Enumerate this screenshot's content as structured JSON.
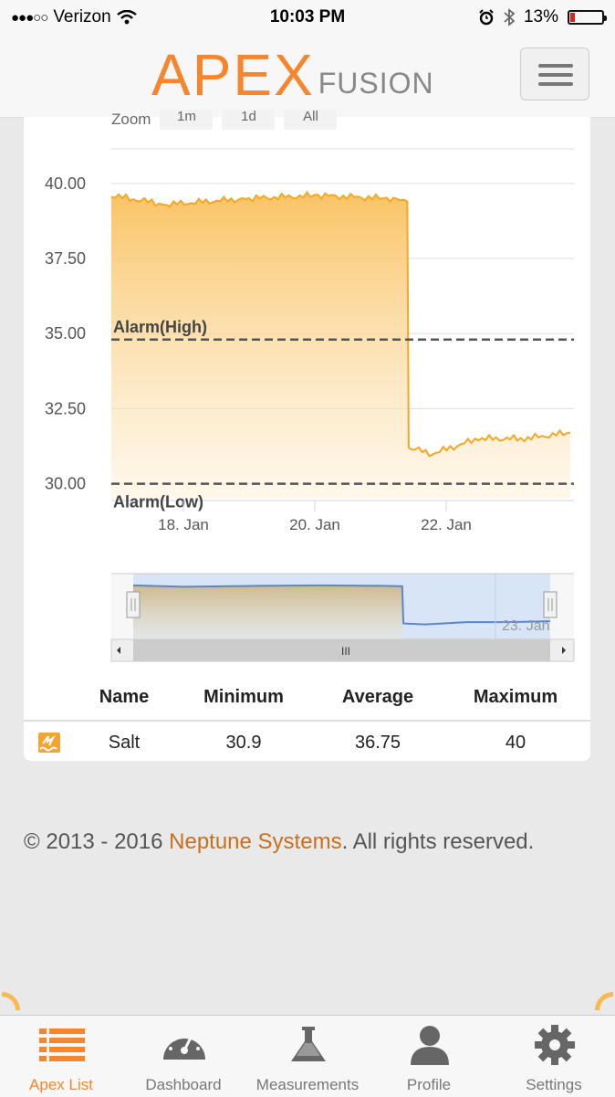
{
  "status_bar": {
    "carrier": "Verizon",
    "time": "10:03 PM",
    "battery": "13%",
    "battery_level": 0.13
  },
  "header": {
    "logo_main": "APEX",
    "logo_sub": "FUSION",
    "menu_icon": "hamburger-icon"
  },
  "chart": {
    "zoom_label": "Zoom",
    "zoom_buttons": [
      "1m",
      "1d",
      "All"
    ]
  },
  "chart_data": {
    "type": "area",
    "title": "",
    "xlabel": "",
    "ylabel": "",
    "ylim": [
      29.5,
      41.0
    ],
    "y_ticks": [
      "40.00",
      "37.50",
      "35.00",
      "32.50",
      "30.00"
    ],
    "x_tick_labels": [
      "18. Jan",
      "20. Jan",
      "22. Jan"
    ],
    "navigator_label": "23. Jan",
    "plot_lines": [
      {
        "label": "Alarm(High)",
        "value": 34.8
      },
      {
        "label": "Alarm(Low)",
        "value": 30.0
      }
    ],
    "series": [
      {
        "name": "Salt",
        "color": "#f5a623",
        "x": [
          "17. Jan",
          "18. Jan",
          "19. Jan",
          "20. Jan",
          "21. Jan",
          "21.5 Jan",
          "21.6 Jan",
          "22. Jan",
          "22.5 Jan",
          "23. Jan",
          "23.5 Jan"
        ],
        "values": [
          39.6,
          39.3,
          39.5,
          39.6,
          39.5,
          39.4,
          31.2,
          31.0,
          31.5,
          31.5,
          31.7
        ]
      }
    ]
  },
  "table": {
    "headers": [
      "Name",
      "Minimum",
      "Average",
      "Maximum"
    ],
    "rows": [
      {
        "icon": "salt-icon",
        "name": "Salt",
        "min": "30.9",
        "avg": "36.75",
        "max": "40"
      }
    ]
  },
  "footer": {
    "copyright": "© 2013 - 2016 ",
    "brand": "Neptune Systems",
    "suffix": ". All rights reserved."
  },
  "tabs": [
    {
      "label": "Apex List",
      "icon": "list-icon",
      "active": true
    },
    {
      "label": "Dashboard",
      "icon": "gauge-icon",
      "active": false
    },
    {
      "label": "Measurements",
      "icon": "flask-icon",
      "active": false
    },
    {
      "label": "Profile",
      "icon": "user-icon",
      "active": false
    },
    {
      "label": "Settings",
      "icon": "gear-icon",
      "active": false
    }
  ],
  "colors": {
    "accent": "#f5862e",
    "series": "#f5a623",
    "navigator": "#5b87c5"
  }
}
